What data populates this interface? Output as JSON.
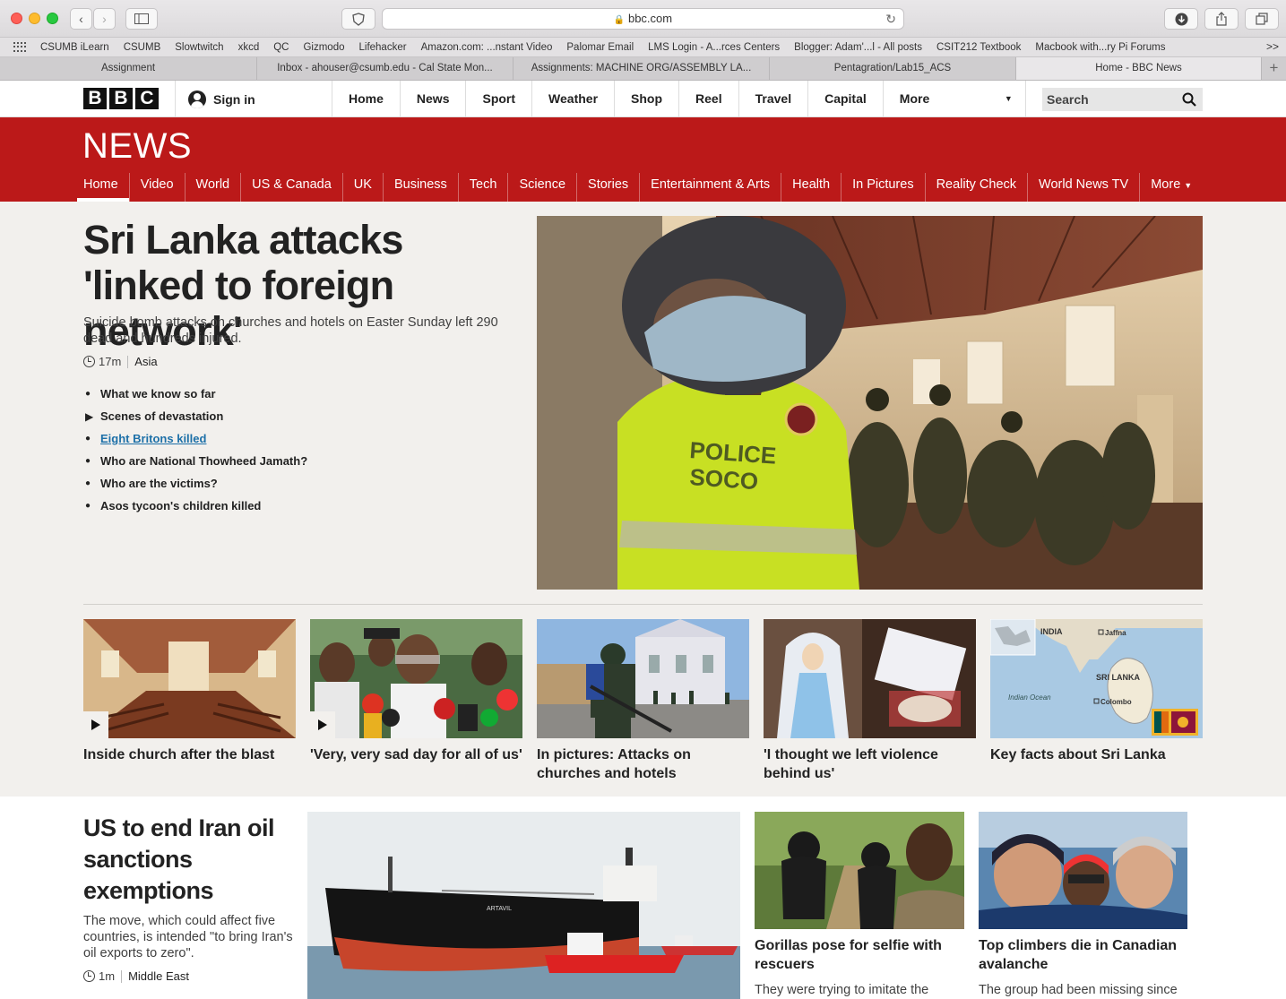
{
  "browser": {
    "url": "bbc.com",
    "favorites": [
      "CSUMB iLearn",
      "CSUMB",
      "Slowtwitch",
      "xkcd",
      "QC",
      "Gizmodo",
      "Lifehacker",
      "Amazon.com: ...nstant Video",
      "Palomar Email",
      "LMS Login - A...rces Centers",
      "Blogger: Adam'...l - All posts",
      "CSIT212 Textbook",
      "Macbook with...ry Pi Forums"
    ],
    "tabs": [
      "Assignment",
      "Inbox - ahouser@csumb.edu - Cal State Mon...",
      "Assignments: MACHINE ORG/ASSEMBLY LA...",
      "Pentagration/Lab15_ACS",
      "Home - BBC News"
    ],
    "more_favorites": ">>",
    "new_tab": "+"
  },
  "bbc_nav": {
    "logo_letters": [
      "B",
      "B",
      "C"
    ],
    "sign_in": "Sign in",
    "items": [
      "Home",
      "News",
      "Sport",
      "Weather",
      "Shop",
      "Reel",
      "Travel",
      "Capital"
    ],
    "more": "More",
    "search_placeholder": "Search"
  },
  "news_header": {
    "title": "NEWS",
    "nav": [
      "Home",
      "Video",
      "World",
      "US & Canada",
      "UK",
      "Business",
      "Tech",
      "Science",
      "Stories",
      "Entertainment & Arts",
      "Health",
      "In Pictures",
      "Reality Check",
      "World News TV"
    ],
    "more": "More",
    "active": "Home"
  },
  "lead": {
    "title": "Sri Lanka attacks 'linked to foreign network'",
    "summary": "Suicide bomb attacks on churches and hotels on Easter Sunday left 290 dead and hundreds injured.",
    "time": "17m",
    "section": "Asia",
    "related": [
      {
        "text": "What we know so far",
        "kind": "bullet"
      },
      {
        "text": "Scenes of devastation",
        "kind": "video"
      },
      {
        "text": "Eight Britons killed",
        "kind": "link"
      },
      {
        "text": "Who are National Thowheed Jamath?",
        "kind": "bullet"
      },
      {
        "text": "Who are the victims?",
        "kind": "bullet"
      },
      {
        "text": "Asos tycoon's children killed",
        "kind": "bullet"
      }
    ],
    "image_text": "POLICE SOCO"
  },
  "cards": [
    {
      "title": "Inside church after the blast",
      "video": true
    },
    {
      "title": "'Very, very sad day for all of us'",
      "video": true
    },
    {
      "title": "In pictures: Attacks on churches and hotels",
      "video": false
    },
    {
      "title": "'I thought we left violence behind us'",
      "video": false
    },
    {
      "title": "Key facts about Sri Lanka",
      "video": false
    }
  ],
  "map_labels": {
    "india": "INDIA",
    "jaffna": "Jaffna",
    "sri_lanka": "SRI LANKA",
    "indian_ocean": "Indian Ocean",
    "colombo": "Colombo"
  },
  "second": {
    "title": "US to end Iran oil sanctions exemptions",
    "summary": "The move, which could affect five countries, is intended \"to bring Iran's oil exports to zero\".",
    "time": "1m",
    "section": "Middle East",
    "ship_name": "ARTAVIL",
    "story2": {
      "title": "Gorillas pose for selfie with rescuers",
      "summary": "They were trying to imitate the"
    },
    "story3": {
      "title": "Top climbers die in Canadian avalanche",
      "summary": "The group had been missing since"
    }
  },
  "colors": {
    "bbc_red": "#bb1919",
    "page_bg": "#f2f0ed",
    "link_blue": "#1d70a8"
  }
}
